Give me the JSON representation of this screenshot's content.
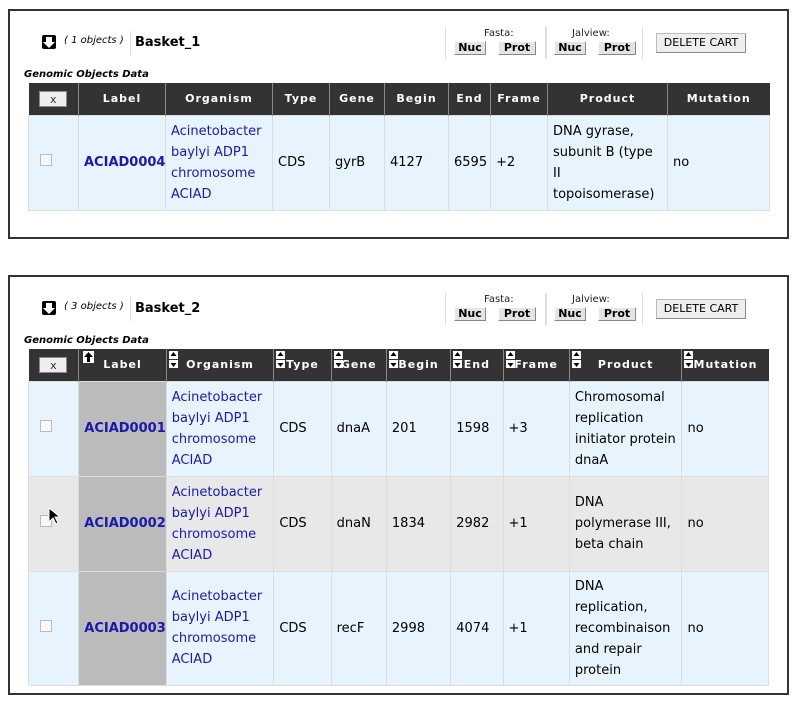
{
  "baskets": [
    {
      "count": "( 1 objects )",
      "name": "Basket_1",
      "fasta": {
        "title": "Fasta:",
        "nuc": "Nuc",
        "prot": "Prot"
      },
      "jalview": {
        "title": "Jalview:",
        "nuc": "Nuc",
        "prot": "Prot"
      },
      "delete_label": "DELETE CART",
      "caption": "Genomic Objects Data",
      "x_label": "x",
      "headers": [
        "Label",
        "Organism",
        "Type",
        "Gene",
        "Begin",
        "End",
        "Frame",
        "Product",
        "Mutation"
      ],
      "rows": [
        {
          "label": "ACIAD0004",
          "organism": [
            "Acinetobacter",
            "baylyi ADP1",
            "chromosome",
            "ACIAD"
          ],
          "type": "CDS",
          "gene": "gyrB",
          "begin": "4127",
          "end": "6595",
          "frame": "+2",
          "product": [
            "DNA gyrase,",
            "subunit B (type II",
            "topoisomerase)"
          ],
          "mutation": "no"
        }
      ]
    },
    {
      "count": "( 3 objects )",
      "name": "Basket_2",
      "fasta": {
        "title": "Fasta:",
        "nuc": "Nuc",
        "prot": "Prot"
      },
      "jalview": {
        "title": "Jalview:",
        "nuc": "Nuc",
        "prot": "Prot"
      },
      "delete_label": "DELETE CART",
      "caption": "Genomic Objects Data",
      "x_label": "x",
      "headers": [
        "Label",
        "Organism",
        "Type",
        "Gene",
        "Begin",
        "End",
        "Frame",
        "Product",
        "Mutation"
      ],
      "rows": [
        {
          "label": "ACIAD0001",
          "organism": [
            "Acinetobacter",
            "baylyi ADP1",
            "chromosome",
            "ACIAD"
          ],
          "type": "CDS",
          "gene": "dnaA",
          "begin": "201",
          "end": "1598",
          "frame": "+3",
          "product": [
            "Chromosomal",
            "replication",
            "initiator protein",
            "dnaA"
          ],
          "mutation": "no"
        },
        {
          "label": "ACIAD0002",
          "organism": [
            "Acinetobacter",
            "baylyi ADP1",
            "chromosome",
            "ACIAD"
          ],
          "type": "CDS",
          "gene": "dnaN",
          "begin": "1834",
          "end": "2982",
          "frame": "+1",
          "product": [
            "DNA",
            "polymerase III,",
            "beta chain"
          ],
          "mutation": "no"
        },
        {
          "label": "ACIAD0003",
          "organism": [
            "Acinetobacter",
            "baylyi ADP1",
            "chromosome",
            "ACIAD"
          ],
          "type": "CDS",
          "gene": "recF",
          "begin": "2998",
          "end": "4074",
          "frame": "+1",
          "product": [
            "DNA replication,",
            "recombinaison",
            "and repair",
            "protein"
          ],
          "mutation": "no"
        }
      ]
    }
  ],
  "icons": {
    "collapse": "arrow-down-icon",
    "sort": "sort-arrows-icon",
    "sorted_asc": "arrow-up-icon",
    "cursor": "mouse-pointer-icon"
  },
  "colors": {
    "header_bg": "#333333",
    "link": "#1a1aaa",
    "row_odd": "#e8f4fd",
    "row_even": "#e8e8e8",
    "sorted_cell": "#bbbbbb"
  }
}
